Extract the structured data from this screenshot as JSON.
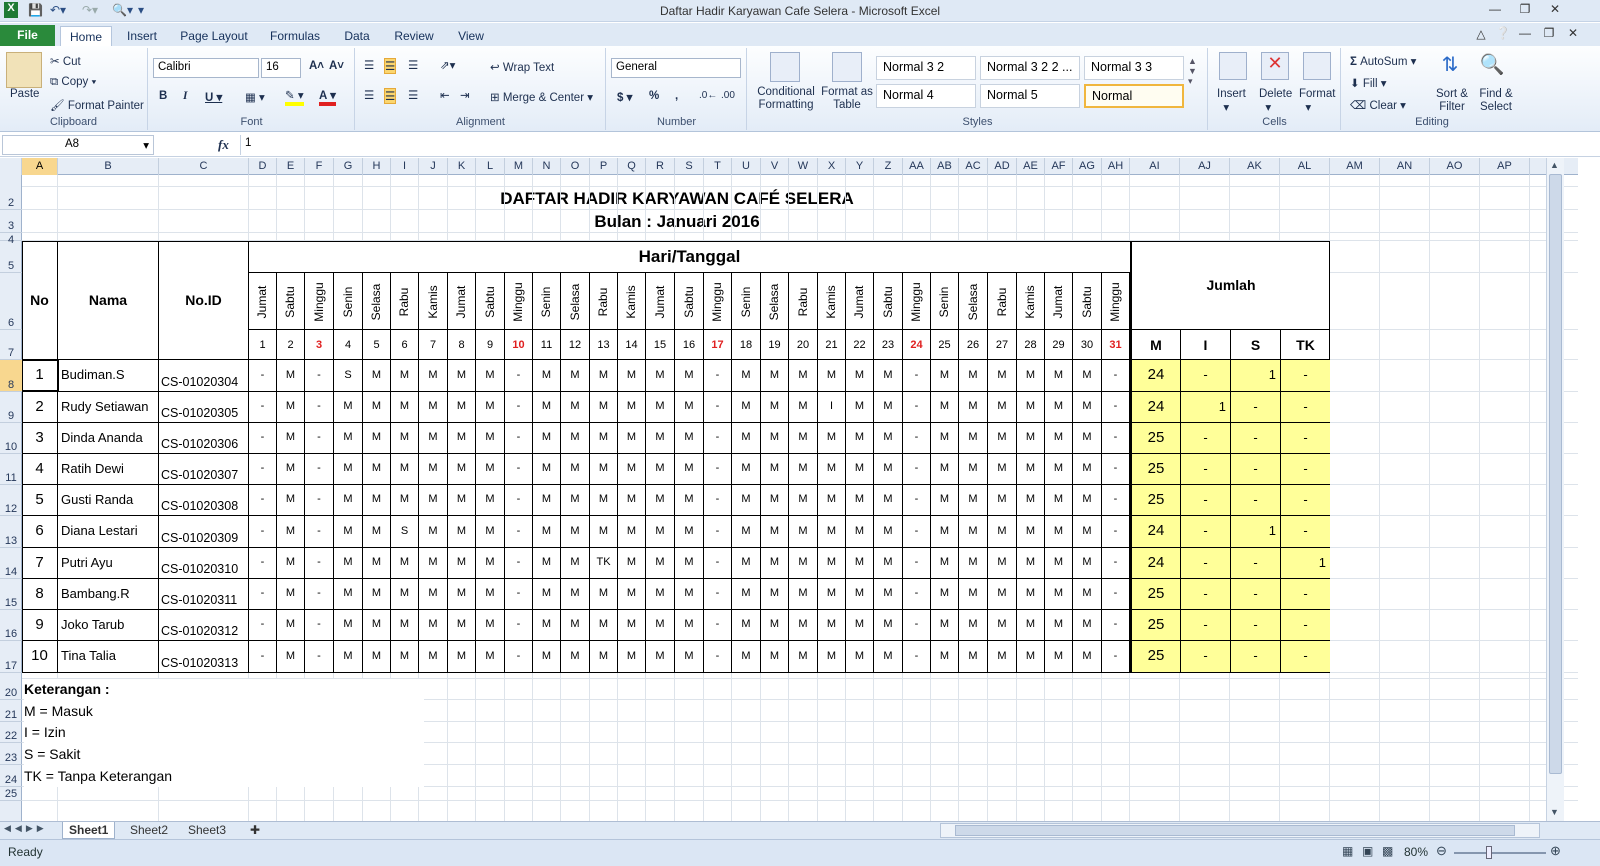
{
  "window": {
    "title": "Daftar Hadir Karyawan Cafe Selera  -  Microsoft Excel"
  },
  "tabs": [
    "File",
    "Home",
    "Insert",
    "Page Layout",
    "Formulas",
    "Data",
    "Review",
    "View"
  ],
  "clipboard": {
    "paste": "Paste",
    "cut": "Cut",
    "copy": "Copy",
    "format_painter": "Format Painter",
    "label": "Clipboard"
  },
  "font": {
    "name": "Calibri",
    "size": "16",
    "label": "Font"
  },
  "alignment": {
    "wrap": "Wrap Text",
    "merge": "Merge & Center",
    "label": "Alignment"
  },
  "number": {
    "format": "General",
    "label": "Number"
  },
  "styles": {
    "cond": "Conditional Formatting",
    "table": "Format as Table",
    "items": [
      "Normal 3 2",
      "Normal 3 2 2 ...",
      "Normal 3 3",
      "Normal 4",
      "Normal 5",
      "Normal"
    ],
    "label": "Styles"
  },
  "cells": {
    "insert": "Insert",
    "delete": "Delete",
    "format": "Format",
    "label": "Cells"
  },
  "editing": {
    "autosum": "AutoSum",
    "fill": "Fill",
    "clear": "Clear",
    "sort": "Sort & Filter",
    "find": "Find & Select",
    "label": "Editing"
  },
  "formula_bar": {
    "name_box": "A8",
    "fx": "fx",
    "value": "1"
  },
  "columns": [
    "A",
    "B",
    "C",
    "D",
    "E",
    "F",
    "G",
    "H",
    "I",
    "J",
    "K",
    "L",
    "M",
    "N",
    "O",
    "P",
    "Q",
    "R",
    "S",
    "T",
    "U",
    "V",
    "W",
    "X",
    "Y",
    "Z",
    "AA",
    "AB",
    "AC",
    "AD",
    "AE",
    "AF",
    "AG",
    "AH",
    "AI",
    "AJ",
    "AK",
    "AL",
    "AM",
    "AN",
    "AO",
    "AP"
  ],
  "rows": [
    "2",
    "3",
    "4",
    "5",
    "6",
    "7",
    "8",
    "9",
    "10",
    "11",
    "12",
    "13",
    "14",
    "15",
    "16",
    "17",
    "20",
    "21",
    "22",
    "23",
    "24",
    "25"
  ],
  "sheet": {
    "title": "DAFTAR HADIR KARYAWAN CAFÉ SELERA",
    "subtitle": "Bulan : Januari 2016",
    "headers": {
      "no": "No",
      "nama": "Nama",
      "id": "No.ID",
      "hari": "Hari/Tanggal",
      "jumlah": "Jumlah",
      "sums": [
        "M",
        "I",
        "S",
        "TK"
      ]
    },
    "days": [
      "Jumat",
      "Sabtu",
      "Minggu",
      "Senin",
      "Selasa",
      "Rabu",
      "Kamis",
      "Jumat",
      "Sabtu",
      "Minggu",
      "Senin",
      "Selasa",
      "Rabu",
      "Kamis",
      "Jumat",
      "Sabtu",
      "Minggu",
      "Senin",
      "Selasa",
      "Rabu",
      "Kamis",
      "Jumat",
      "Sabtu",
      "Minggu",
      "Senin",
      "Selasa",
      "Rabu",
      "Kamis",
      "Jumat",
      "Sabtu",
      "Minggu"
    ],
    "dates": [
      "1",
      "2",
      "3",
      "4",
      "5",
      "6",
      "7",
      "8",
      "9",
      "10",
      "11",
      "12",
      "13",
      "14",
      "15",
      "16",
      "17",
      "18",
      "19",
      "20",
      "21",
      "22",
      "23",
      "24",
      "25",
      "26",
      "27",
      "28",
      "29",
      "30",
      "31"
    ],
    "employees": [
      {
        "no": "1",
        "name": "Budiman.S",
        "id": "CS-01020304",
        "att": [
          "-",
          "M",
          "-",
          "S",
          "M",
          "M",
          "M",
          "M",
          "M",
          "-",
          "M",
          "M",
          "M",
          "M",
          "M",
          "M",
          "-",
          "M",
          "M",
          "M",
          "M",
          "M",
          "M",
          "-",
          "M",
          "M",
          "M",
          "M",
          "M",
          "M",
          "-"
        ],
        "m": "24",
        "i": "-",
        "s": "1",
        "tk": "-"
      },
      {
        "no": "2",
        "name": "Rudy Setiawan",
        "id": "CS-01020305",
        "att": [
          "-",
          "M",
          "-",
          "M",
          "M",
          "M",
          "M",
          "M",
          "M",
          "-",
          "M",
          "M",
          "M",
          "M",
          "M",
          "M",
          "-",
          "M",
          "M",
          "M",
          "I",
          "M",
          "M",
          "-",
          "M",
          "M",
          "M",
          "M",
          "M",
          "M",
          "-"
        ],
        "m": "24",
        "i": "1",
        "s": "-",
        "tk": "-"
      },
      {
        "no": "3",
        "name": "Dinda Ananda",
        "id": "CS-01020306",
        "att": [
          "-",
          "M",
          "-",
          "M",
          "M",
          "M",
          "M",
          "M",
          "M",
          "-",
          "M",
          "M",
          "M",
          "M",
          "M",
          "M",
          "-",
          "M",
          "M",
          "M",
          "M",
          "M",
          "M",
          "-",
          "M",
          "M",
          "M",
          "M",
          "M",
          "M",
          "-"
        ],
        "m": "25",
        "i": "-",
        "s": "-",
        "tk": "-"
      },
      {
        "no": "4",
        "name": "Ratih Dewi",
        "id": "CS-01020307",
        "att": [
          "-",
          "M",
          "-",
          "M",
          "M",
          "M",
          "M",
          "M",
          "M",
          "-",
          "M",
          "M",
          "M",
          "M",
          "M",
          "M",
          "-",
          "M",
          "M",
          "M",
          "M",
          "M",
          "M",
          "-",
          "M",
          "M",
          "M",
          "M",
          "M",
          "M",
          "-"
        ],
        "m": "25",
        "i": "-",
        "s": "-",
        "tk": "-"
      },
      {
        "no": "5",
        "name": "Gusti Randa",
        "id": "CS-01020308",
        "att": [
          "-",
          "M",
          "-",
          "M",
          "M",
          "M",
          "M",
          "M",
          "M",
          "-",
          "M",
          "M",
          "M",
          "M",
          "M",
          "M",
          "-",
          "M",
          "M",
          "M",
          "M",
          "M",
          "M",
          "-",
          "M",
          "M",
          "M",
          "M",
          "M",
          "M",
          "-"
        ],
        "m": "25",
        "i": "-",
        "s": "-",
        "tk": "-"
      },
      {
        "no": "6",
        "name": "Diana Lestari",
        "id": "CS-01020309",
        "att": [
          "-",
          "M",
          "-",
          "M",
          "M",
          "S",
          "M",
          "M",
          "M",
          "-",
          "M",
          "M",
          "M",
          "M",
          "M",
          "M",
          "-",
          "M",
          "M",
          "M",
          "M",
          "M",
          "M",
          "-",
          "M",
          "M",
          "M",
          "M",
          "M",
          "M",
          "-"
        ],
        "m": "24",
        "i": "-",
        "s": "1",
        "tk": "-"
      },
      {
        "no": "7",
        "name": "Putri Ayu",
        "id": "CS-01020310",
        "att": [
          "-",
          "M",
          "-",
          "M",
          "M",
          "M",
          "M",
          "M",
          "M",
          "-",
          "M",
          "M",
          "TK",
          "M",
          "M",
          "M",
          "-",
          "M",
          "M",
          "M",
          "M",
          "M",
          "M",
          "-",
          "M",
          "M",
          "M",
          "M",
          "M",
          "M",
          "-"
        ],
        "m": "24",
        "i": "-",
        "s": "-",
        "tk": "1"
      },
      {
        "no": "8",
        "name": "Bambang.R",
        "id": "CS-01020311",
        "att": [
          "-",
          "M",
          "-",
          "M",
          "M",
          "M",
          "M",
          "M",
          "M",
          "-",
          "M",
          "M",
          "M",
          "M",
          "M",
          "M",
          "-",
          "M",
          "M",
          "M",
          "M",
          "M",
          "M",
          "-",
          "M",
          "M",
          "M",
          "M",
          "M",
          "M",
          "-"
        ],
        "m": "25",
        "i": "-",
        "s": "-",
        "tk": "-"
      },
      {
        "no": "9",
        "name": "Joko Tarub",
        "id": "CS-01020312",
        "att": [
          "-",
          "M",
          "-",
          "M",
          "M",
          "M",
          "M",
          "M",
          "M",
          "-",
          "M",
          "M",
          "M",
          "M",
          "M",
          "M",
          "-",
          "M",
          "M",
          "M",
          "M",
          "M",
          "M",
          "-",
          "M",
          "M",
          "M",
          "M",
          "M",
          "M",
          "-"
        ],
        "m": "25",
        "i": "-",
        "s": "-",
        "tk": "-"
      },
      {
        "no": "10",
        "name": "Tina Talia",
        "id": "CS-01020313",
        "att": [
          "-",
          "M",
          "-",
          "M",
          "M",
          "M",
          "M",
          "M",
          "M",
          "-",
          "M",
          "M",
          "M",
          "M",
          "M",
          "M",
          "-",
          "M",
          "M",
          "M",
          "M",
          "M",
          "M",
          "-",
          "M",
          "M",
          "M",
          "M",
          "M",
          "M",
          "-"
        ],
        "m": "25",
        "i": "-",
        "s": "-",
        "tk": "-"
      }
    ],
    "legend": [
      "Keterangan :",
      "M = Masuk",
      "I = Izin",
      "S = Sakit",
      "TK = Tanpa Keterangan"
    ]
  },
  "sheet_tabs": [
    "Sheet1",
    "Sheet2",
    "Sheet3"
  ],
  "status": {
    "ready": "Ready",
    "zoom": "80%"
  },
  "colors": {
    "sum_fill": "#ffff99",
    "sunday_red": "#e02020",
    "selected_header": "#f8d78f"
  }
}
